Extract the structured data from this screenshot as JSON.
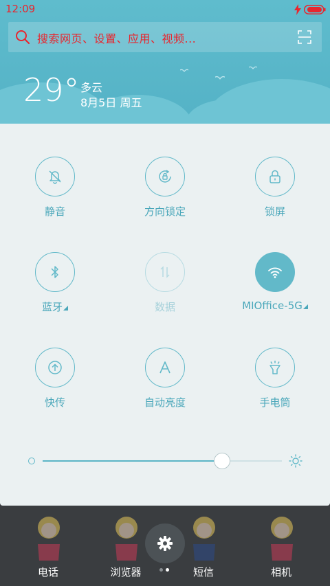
{
  "status_bar": {
    "time": "12:09"
  },
  "search": {
    "placeholder": "搜索网页、设置、应用、视频..."
  },
  "weather": {
    "temperature": "29°",
    "condition": "多云",
    "date": "8月5日 周五"
  },
  "toggles": [
    {
      "id": "mute",
      "label": "静音",
      "icon": "bell-off-icon",
      "state": "off"
    },
    {
      "id": "rotation-lock",
      "label": "方向锁定",
      "icon": "rotation-lock-icon",
      "state": "off"
    },
    {
      "id": "lock-screen",
      "label": "锁屏",
      "icon": "lock-icon",
      "state": "off"
    },
    {
      "id": "bluetooth",
      "label": "蓝牙",
      "icon": "bluetooth-icon",
      "state": "off",
      "expandable": true
    },
    {
      "id": "mobile-data",
      "label": "数据",
      "icon": "data-arrows-icon",
      "state": "disabled"
    },
    {
      "id": "wifi",
      "label": "MIOffice-5G",
      "icon": "wifi-icon",
      "state": "on",
      "expandable": true
    },
    {
      "id": "quick-share",
      "label": "快传",
      "icon": "upload-icon",
      "state": "off"
    },
    {
      "id": "auto-brightness",
      "label": "自动亮度",
      "icon": "auto-a-icon",
      "state": "off"
    },
    {
      "id": "flashlight",
      "label": "手电筒",
      "icon": "flashlight-icon",
      "state": "off"
    }
  ],
  "brightness": {
    "level": 0.75
  },
  "dock": {
    "apps": [
      {
        "label": "电话",
        "icon": "phone-app-icon"
      },
      {
        "label": "浏览器",
        "icon": "browser-app-icon"
      },
      {
        "label": "短信",
        "icon": "sms-app-icon"
      },
      {
        "label": "相机",
        "icon": "camera-app-icon"
      }
    ],
    "pages": {
      "count": 2,
      "current": 1
    }
  },
  "colors": {
    "accent": "#62b9c9",
    "header": "#5fbccd",
    "alert_red": "#e8262e",
    "panel_bg": "#ebf1f2"
  }
}
